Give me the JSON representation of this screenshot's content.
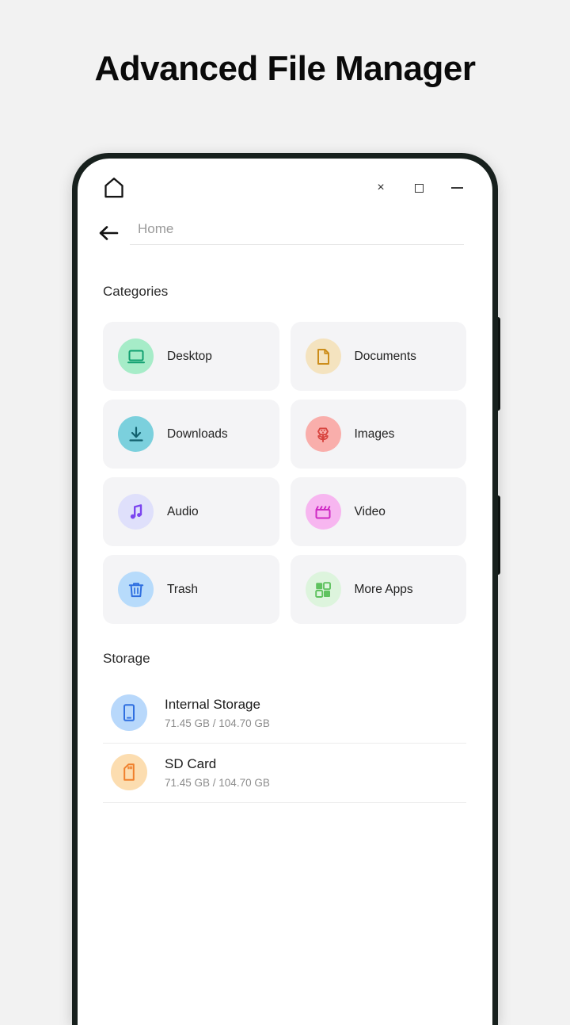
{
  "page": {
    "heading": "Advanced File Manager",
    "background_color": "#f2f2f2"
  },
  "app": {
    "logo_icon": "home-icon",
    "window_controls": [
      {
        "name": "close",
        "glyph": "×"
      },
      {
        "name": "maximize",
        "glyph": "□"
      },
      {
        "name": "minimize",
        "glyph": "—"
      }
    ],
    "pathbar": {
      "back_icon": "arrow-left-icon",
      "path_value": "Home"
    }
  },
  "categories": {
    "section_title": "Categories",
    "items": [
      {
        "label": "Desktop",
        "icon": "monitor-icon",
        "circle_color": "#a6ecc8",
        "icon_color": "#10a070"
      },
      {
        "label": "Documents",
        "icon": "document-icon",
        "circle_color": "#f4e3bf",
        "icon_color": "#cc8d1a"
      },
      {
        "label": "Downloads",
        "icon": "download-icon",
        "circle_color": "#7bd0dd",
        "icon_color": "#12616e"
      },
      {
        "label": "Images",
        "icon": "flower-icon",
        "circle_color": "#f9aeab",
        "icon_color": "#d8443f"
      },
      {
        "label": "Audio",
        "icon": "music-note-icon",
        "circle_color": "#dfe0fb",
        "icon_color": "#7b45ef"
      },
      {
        "label": "Video",
        "icon": "clapperboard-icon",
        "circle_color": "#f7b6f0",
        "icon_color": "#cf29c4"
      },
      {
        "label": "Trash",
        "icon": "trash-icon",
        "circle_color": "#b7dbfb",
        "icon_color": "#2f6fe0"
      },
      {
        "label": "More Apps",
        "icon": "grid-apps-icon",
        "circle_color": "#ddf4dd",
        "icon_color": "#5fc25f"
      }
    ]
  },
  "storage": {
    "section_title": "Storage",
    "items": [
      {
        "name": "Internal Storage",
        "usage": "71.45 GB / 104.70 GB",
        "icon": "smartphone-icon",
        "circle_color": "#b8d8fb",
        "icon_color": "#2f6fe0"
      },
      {
        "name": "SD Card",
        "usage": "71.45 GB / 104.70 GB",
        "icon": "sd-card-icon",
        "circle_color": "#fcddb0",
        "icon_color": "#f0802c"
      }
    ]
  }
}
